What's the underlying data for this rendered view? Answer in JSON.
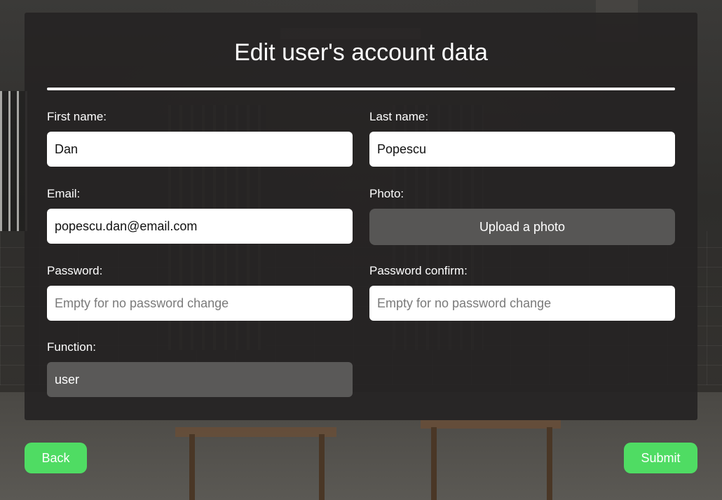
{
  "form": {
    "title": "Edit user's account data",
    "first_name": {
      "label": "First name:",
      "value": "Dan"
    },
    "last_name": {
      "label": "Last name:",
      "value": "Popescu"
    },
    "email": {
      "label": "Email:",
      "value": "popescu.dan@email.com"
    },
    "photo": {
      "label": "Photo:",
      "button_label": "Upload a photo"
    },
    "password": {
      "label": "Password:",
      "placeholder": "Empty for no password change"
    },
    "password_confirm": {
      "label": "Password confirm:",
      "placeholder": "Empty for no password change"
    },
    "function": {
      "label": "Function:",
      "value": "user"
    }
  },
  "actions": {
    "back_label": "Back",
    "submit_label": "Submit"
  },
  "colors": {
    "accent_button": "#4fdc63",
    "panel": "#262423",
    "upload_button": "#575655"
  }
}
